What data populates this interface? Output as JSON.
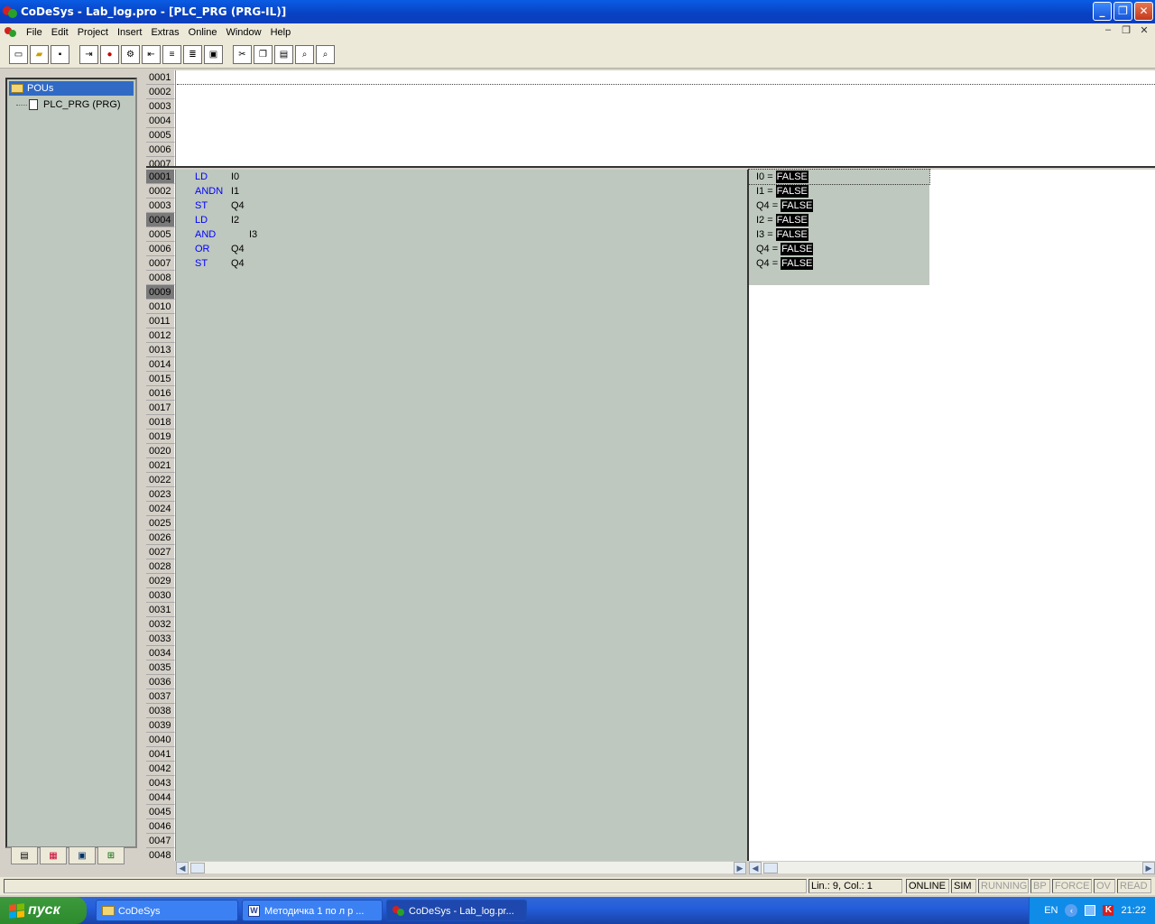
{
  "window": {
    "title": "CoDeSys - Lab_log.pro - [PLC_PRG (PRG-IL)]"
  },
  "menu": [
    "File",
    "Edit",
    "Project",
    "Insert",
    "Extras",
    "Online",
    "Window",
    "Help"
  ],
  "toolbar": {
    "buttons": [
      "new",
      "open",
      "save",
      "login",
      "stop",
      "run",
      "logout",
      "step-over",
      "step-in",
      "breakpoint",
      "cut",
      "copy",
      "paste",
      "find",
      "find-next"
    ]
  },
  "tree": {
    "root": "POUs",
    "child": "PLC_PRG (PRG)"
  },
  "decl_lines": [
    "0001",
    "0002",
    "0003",
    "0004",
    "0005",
    "0006",
    "0007"
  ],
  "body_lines": [
    "0001",
    "0002",
    "0003",
    "0004",
    "0005",
    "0006",
    "0007",
    "0008",
    "0009",
    "0010",
    "0011",
    "0012",
    "0013",
    "0014",
    "0015",
    "0016",
    "0017",
    "0018",
    "0019",
    "0020",
    "0021",
    "0022",
    "0023",
    "0024",
    "0025",
    "0026",
    "0027",
    "0028",
    "0029",
    "0030",
    "0031",
    "0032",
    "0033",
    "0034",
    "0035",
    "0036",
    "0037",
    "0038",
    "0039",
    "0040",
    "0041",
    "0042",
    "0043",
    "0044",
    "0045",
    "0046",
    "0047",
    "0048"
  ],
  "breakpoint_lines": [
    "0001",
    "0004",
    "0009"
  ],
  "code": [
    {
      "op": "LD",
      "arg": "I0"
    },
    {
      "op": "ANDN",
      "arg": "I1"
    },
    {
      "op": "ST",
      "arg": "Q4"
    },
    {
      "op": "LD",
      "arg": "I2"
    },
    {
      "op": "AND",
      "arg": "I3"
    },
    {
      "op": "OR",
      "arg": "Q4"
    },
    {
      "op": "ST",
      "arg": "Q4"
    }
  ],
  "monitor": [
    {
      "var": "I0 =",
      "val": "FALSE"
    },
    {
      "var": "I1 =",
      "val": "FALSE"
    },
    {
      "var": "Q4 =",
      "val": "FALSE"
    },
    {
      "var": "I2 =",
      "val": "FALSE"
    },
    {
      "var": "I3 =",
      "val": "FALSE"
    },
    {
      "var": "Q4 =",
      "val": "FALSE"
    },
    {
      "var": "Q4 =",
      "val": "FALSE"
    }
  ],
  "status": {
    "position": "Lin.: 9, Col.: 1",
    "online": "ONLINE",
    "sim": "SIM",
    "running": "RUNNING",
    "bp": "BP",
    "force": "FORCE",
    "ov": "OV",
    "read": "READ"
  },
  "taskbar": {
    "start": "пуск",
    "tasks": [
      "CoDeSys",
      "Методичка 1 по л р ...",
      "CoDeSys - Lab_log.pr..."
    ],
    "lang": "EN",
    "clock": "21:22"
  },
  "colors": {
    "keyword": "#0000ff",
    "editor_bg": "#bec8be",
    "title_blue": "#0a5ce4"
  }
}
